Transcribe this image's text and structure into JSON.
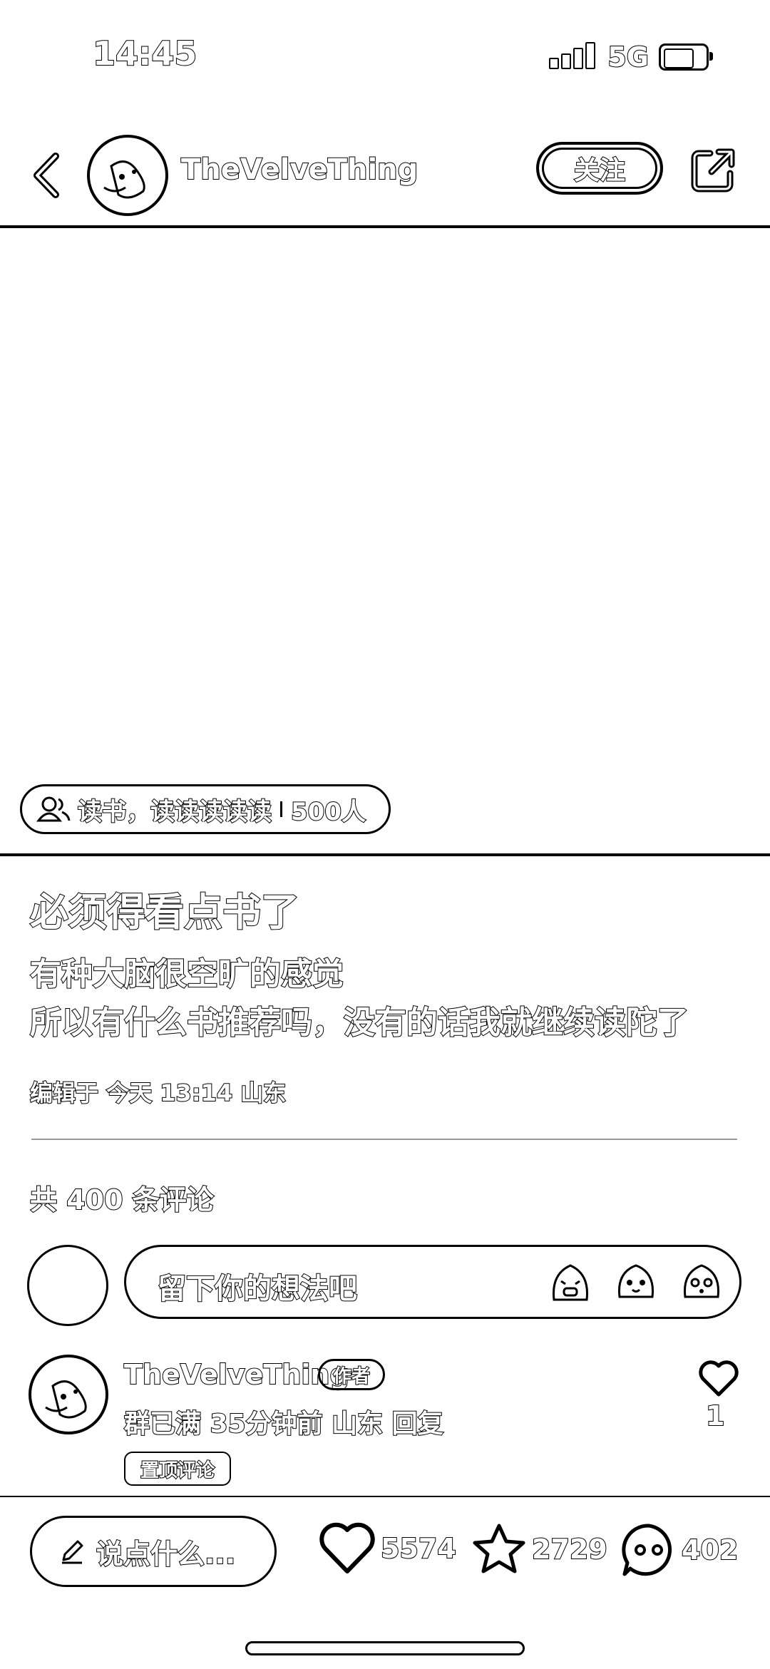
{
  "status_bar": {
    "time": "14:45",
    "network": "5G"
  },
  "header": {
    "author_name": "TheVelveThing",
    "follow_label": "关注"
  },
  "group_tag": {
    "label": "读书，读读读读读",
    "members": "500人"
  },
  "post": {
    "title": "必须得看点书了",
    "lines": [
      "有种大脑很空旷的感觉",
      "所以有什么书推荐吗，没有的话我就继续读陀了"
    ],
    "meta": "编辑于 今天 13:14 山东"
  },
  "comments_section": {
    "count_label": "共 400 条评论",
    "input_placeholder": "留下你的想法吧",
    "emojis": [
      "crying-emoji-icon",
      "smile-emoji-icon",
      "surprised-emoji-icon"
    ]
  },
  "comment": {
    "author": "TheVelveThing",
    "badge": "作者",
    "text": "群已满 35分钟前 山东 回复",
    "pinned": "置顶评论",
    "likes": "1"
  },
  "bottom_bar": {
    "say_placeholder": "说点什么...",
    "likes": "5574",
    "favorites": "2729",
    "comments": "402"
  }
}
